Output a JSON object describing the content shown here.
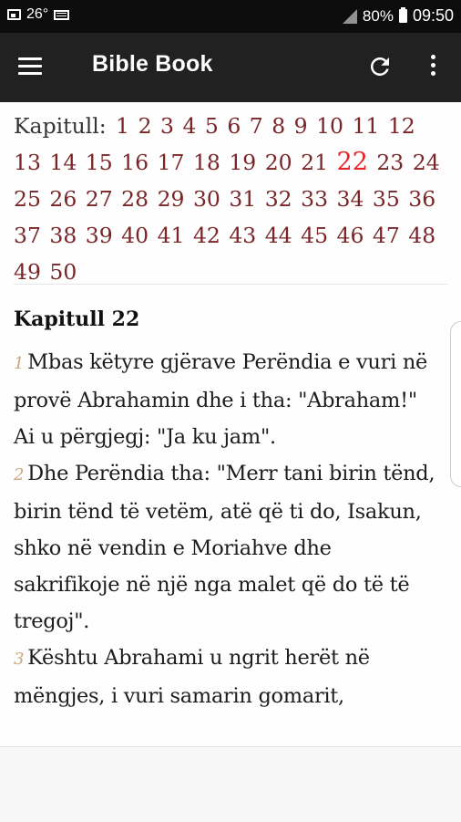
{
  "status_bar": {
    "temperature": "26°",
    "battery": "80%",
    "time": "09:50",
    "icons": [
      "image-icon",
      "keyboard-icon",
      "signal-icon",
      "battery-icon"
    ]
  },
  "app_bar": {
    "title": "Bible Book",
    "background": "#212121",
    "icons": [
      "menu-icon",
      "refresh-icon",
      "more-vert-icon"
    ]
  },
  "chapter_nav": {
    "label": "Kapitull:",
    "chapters": [
      "1",
      "2",
      "3",
      "4",
      "5",
      "6",
      "7",
      "8",
      "9",
      "10",
      "11",
      "12",
      "13",
      "14",
      "15",
      "16",
      "17",
      "18",
      "19",
      "20",
      "21",
      "22",
      "23",
      "24",
      "25",
      "26",
      "27",
      "28",
      "29",
      "30",
      "31",
      "32",
      "33",
      "34",
      "35",
      "36",
      "37",
      "38",
      "39",
      "40",
      "41",
      "42",
      "43",
      "44",
      "45",
      "46",
      "47",
      "48",
      "49",
      "50"
    ],
    "current": "22",
    "link_color": "#7a2528",
    "current_color": "#e8242b"
  },
  "chapter": {
    "heading": "Kapitull 22",
    "verses": [
      {
        "num": "1",
        "text": "Mbas këtyre gjërave Perëndia e vuri në provë Abrahamin dhe i tha: \"Abraham!\" Ai u përgjegj: \"Ja ku jam\"."
      },
      {
        "num": "2",
        "text": "Dhe Perëndia tha: \"Merr tani birin tënd, birin tënd të vetëm, atë që ti do, Isakun, shko në vendin e Moriahve dhe sakrifikoje në një nga malet që do të të tregoj\"."
      },
      {
        "num": "3",
        "text": "Kështu Abrahami u ngrit herët në mëngjes, i vuri samarin gomarit,"
      }
    ],
    "verse_number_color": "#caa67a"
  }
}
